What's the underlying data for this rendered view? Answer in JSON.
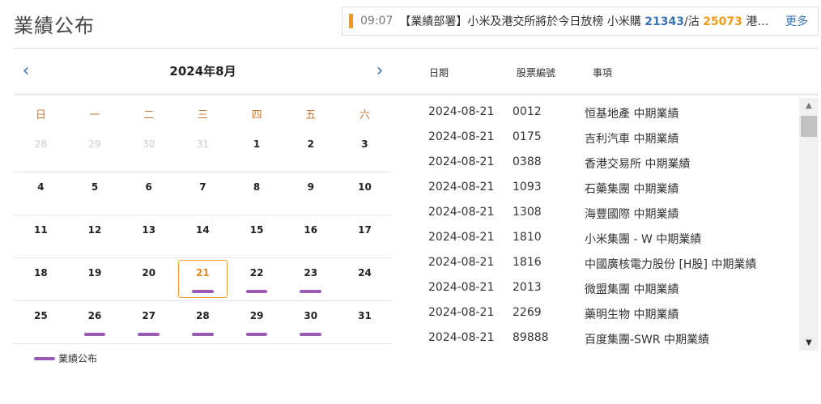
{
  "page": {
    "title": "業績公布"
  },
  "ticker": {
    "time": "09:07",
    "text_prefix": "【業績部署】小米及港交所將於今日放榜 小米購 ",
    "value1": "21343",
    "sep": "/沽 ",
    "value2": "25073",
    "text_suffix": " 港交所購…",
    "more": "更多"
  },
  "calendar": {
    "month_label": "2024年8月",
    "prev_icon": "‹",
    "next_icon": "›",
    "weekdays": [
      "日",
      "一",
      "二",
      "三",
      "四",
      "五",
      "六"
    ],
    "weeks": [
      [
        {
          "d": "28",
          "other": true
        },
        {
          "d": "29",
          "other": true
        },
        {
          "d": "30",
          "other": true
        },
        {
          "d": "31",
          "other": true
        },
        {
          "d": "1"
        },
        {
          "d": "2"
        },
        {
          "d": "3"
        }
      ],
      [
        {
          "d": "4"
        },
        {
          "d": "5"
        },
        {
          "d": "6"
        },
        {
          "d": "7"
        },
        {
          "d": "8"
        },
        {
          "d": "9"
        },
        {
          "d": "10"
        }
      ],
      [
        {
          "d": "11"
        },
        {
          "d": "12"
        },
        {
          "d": "13"
        },
        {
          "d": "14"
        },
        {
          "d": "15"
        },
        {
          "d": "16"
        },
        {
          "d": "17"
        }
      ],
      [
        {
          "d": "18"
        },
        {
          "d": "19"
        },
        {
          "d": "20"
        },
        {
          "d": "21",
          "today": true,
          "mark": true
        },
        {
          "d": "22",
          "mark": true
        },
        {
          "d": "23",
          "mark": true
        },
        {
          "d": "24"
        }
      ],
      [
        {
          "d": "25"
        },
        {
          "d": "26",
          "mark": true
        },
        {
          "d": "27",
          "mark": true
        },
        {
          "d": "28",
          "mark": true
        },
        {
          "d": "29",
          "mark": true
        },
        {
          "d": "30",
          "mark": true
        },
        {
          "d": "31"
        }
      ]
    ],
    "legend_label": "業績公布",
    "mark_color": "#9b59b6"
  },
  "list": {
    "headers": {
      "date": "日期",
      "code": "股票編號",
      "item": "事項"
    },
    "rows": [
      {
        "date": "2024-08-21",
        "code": "0012",
        "item": "恒基地產 中期業績"
      },
      {
        "date": "2024-08-21",
        "code": "0175",
        "item": "吉利汽車 中期業績"
      },
      {
        "date": "2024-08-21",
        "code": "0388",
        "item": "香港交易所 中期業績"
      },
      {
        "date": "2024-08-21",
        "code": "1093",
        "item": "石藥集團 中期業績"
      },
      {
        "date": "2024-08-21",
        "code": "1308",
        "item": "海豐國際 中期業績"
      },
      {
        "date": "2024-08-21",
        "code": "1810",
        "item": "小米集團 - W 中期業績"
      },
      {
        "date": "2024-08-21",
        "code": "1816",
        "item": "中國廣核電力股份 [H股] 中期業績"
      },
      {
        "date": "2024-08-21",
        "code": "2013",
        "item": "微盟集團 中期業績"
      },
      {
        "date": "2024-08-21",
        "code": "2269",
        "item": "藥明生物 中期業績"
      },
      {
        "date": "2024-08-21",
        "code": "89888",
        "item": "百度集團-SWR 中期業績"
      }
    ]
  },
  "colors": {
    "accent": "#3a74b5",
    "orange": "#f29a16",
    "purple": "#9b59b6"
  }
}
